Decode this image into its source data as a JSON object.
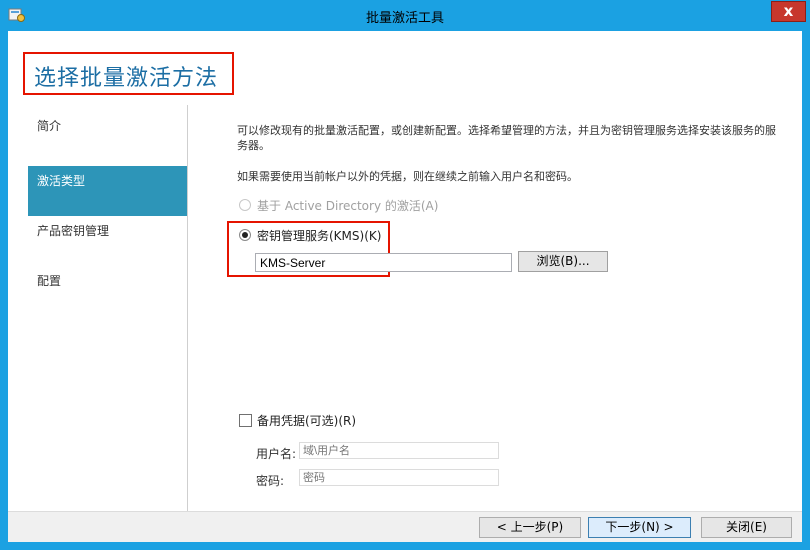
{
  "window": {
    "title": "批量激活工具",
    "close_label": "x"
  },
  "header": {
    "title_prefix": "选择",
    "title_main": "批量激活方法"
  },
  "sidebar": {
    "items": [
      {
        "label": "简介"
      },
      {
        "label": "激活类型"
      },
      {
        "label": "产品密钥管理"
      },
      {
        "label": "配置"
      }
    ],
    "active_index": 1
  },
  "main": {
    "description": "可以修改现有的批量激活配置，或创建新配置。选择希望管理的方法，并且为密钥管理服务选择安装该服务的服务器。",
    "credentials_hint": "如果需要使用当前帐户以外的凭据，则在继续之前输入用户名和密码。",
    "options": [
      {
        "label": "基于 Active Directory 的激活(A)",
        "checked": false,
        "enabled": false
      },
      {
        "label": "密钥管理服务(KMS)(K)",
        "checked": true,
        "enabled": true
      }
    ],
    "kms_server_value": "KMS-Server",
    "browse_label": "浏览(B)...",
    "alt_credentials": {
      "label": "备用凭据(可选)(R)",
      "checked": false
    },
    "username_label": "用户名:",
    "username_placeholder": "域\\用户名",
    "password_label": "密码:",
    "password_placeholder": "密码"
  },
  "footer": {
    "back_label": "< 上一步(P)",
    "next_label": "下一步(N) >",
    "close_label": "关闭(E)"
  },
  "colors": {
    "title_bar": "#1ba1e2",
    "accent_active": "#2d95b8",
    "highlight_box": "#e51400",
    "title_text": "#1c6ea4"
  }
}
